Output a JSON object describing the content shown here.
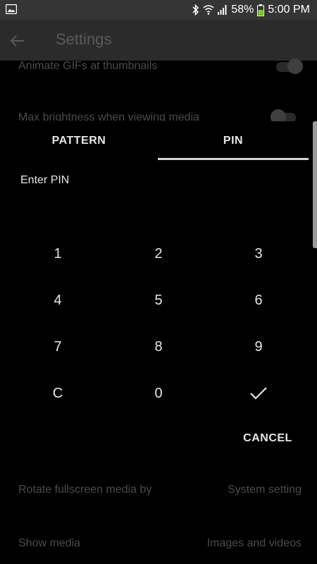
{
  "status_bar": {
    "battery_percent": "58%",
    "time": "5:00 PM",
    "icons": [
      "image-notification-icon",
      "bluetooth-icon",
      "wifi-icon",
      "signal-icon",
      "battery-icon"
    ]
  },
  "app_bar": {
    "title": "Settings",
    "back_icon": "arrow-left-icon"
  },
  "background_settings": {
    "animate_gifs": {
      "label": "Animate GIFs at thumbnails",
      "enabled": true
    },
    "max_brightness": {
      "label": "Max brightness when viewing media",
      "enabled": false
    },
    "rotate": {
      "label": "Rotate fullscreen media by",
      "value": "System setting"
    },
    "show_media": {
      "label": "Show media",
      "value": "Images and videos"
    }
  },
  "dialog": {
    "tabs": [
      "PATTERN",
      "PIN"
    ],
    "selected_tab": "PIN",
    "prompt": "Enter PIN",
    "keys": {
      "k1": "1",
      "k2": "2",
      "k3": "3",
      "k4": "4",
      "k5": "5",
      "k6": "6",
      "k7": "7",
      "k8": "8",
      "k9": "9",
      "clear": "C",
      "k0": "0",
      "confirm_icon": "checkmark-icon"
    },
    "cancel_label": "CANCEL"
  },
  "colors": {
    "background": "#000000",
    "status_bar": "#353535",
    "app_bar": "#2b2b2b",
    "text_primary": "#e6e6e6",
    "text_dimmed": "#4b4b4b"
  }
}
